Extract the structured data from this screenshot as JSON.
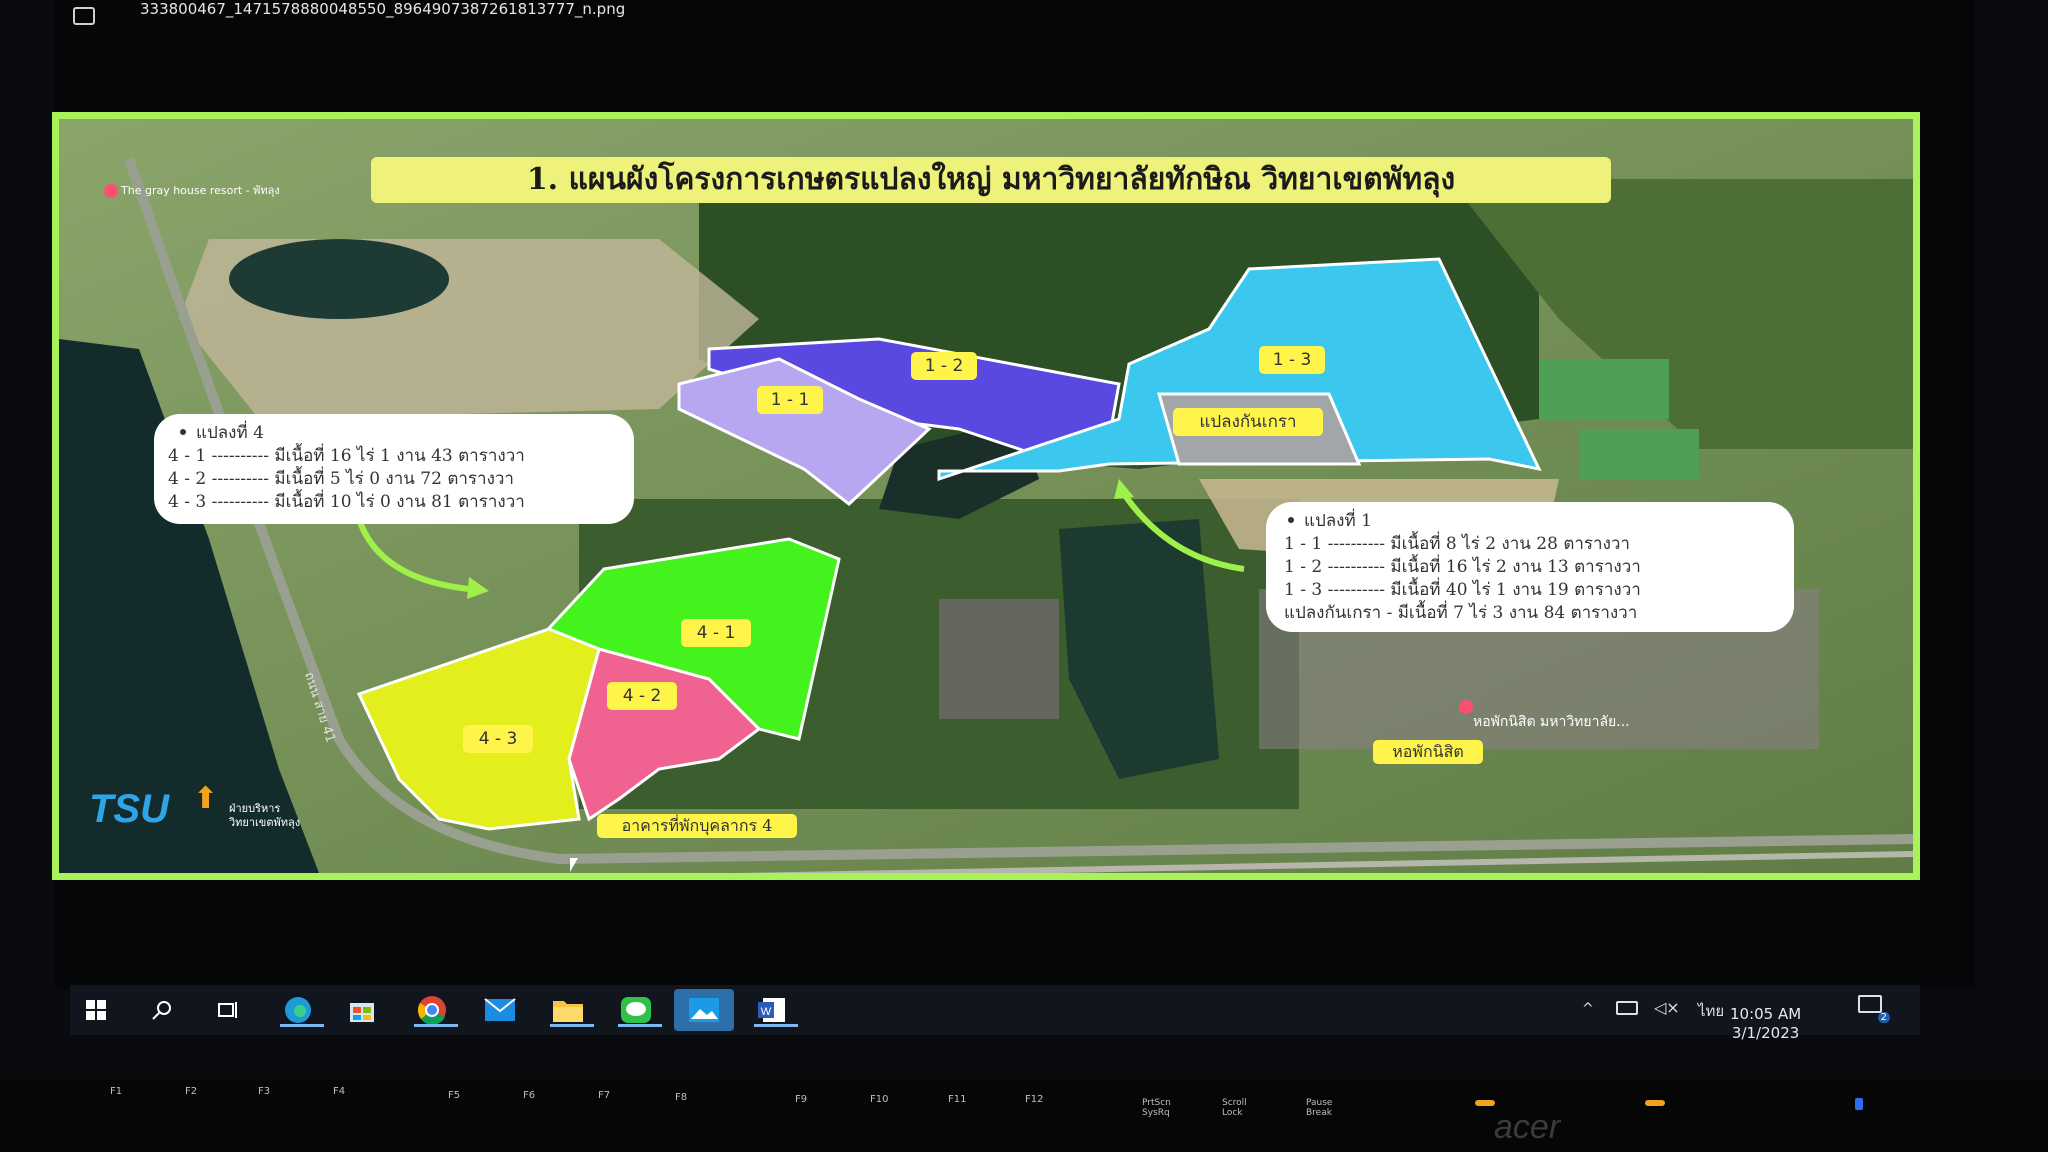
{
  "window": {
    "filename": "333800467_1471578880048550_8964907387261813777_n.png"
  },
  "slide": {
    "title": "1. แผนผังโครงการเกษตรแปลงใหญ่ มหาวิทยาลัยทักษิณ วิทยาเขตพัทลุง",
    "map_pin_label": "The gray house resort - พัทลุง",
    "road_label": "ถนน สาย 41",
    "plot_labels": [
      "1 - 1",
      "1 - 2",
      "1 - 3",
      "แปลงกันเกรา",
      "4 - 1",
      "4 - 2",
      "4 - 3"
    ],
    "place_labels": {
      "staff_building": "อาคารที่พักบุคลากร 4",
      "dormitory": "หอพักนิสิต",
      "dorm_pin": "หอพักนิสิต มหาวิทยาลัย..."
    },
    "callout_plot4": {
      "heading": "แปลงที่ 4",
      "rows": [
        "4 - 1 ----------   มีเนื้อที่  16 ไร่ 1 งาน 43  ตารางวา",
        "4 - 2 ----------   มีเนื้อที่  5  ไร่ 0 งาน 72 ตารางวา",
        "4 - 3 ----------   มีเนื้อที่  10 ไร่ 0 งาน 81 ตารางวา"
      ]
    },
    "callout_plot1": {
      "heading": "แปลงที่ 1",
      "rows": [
        "1 - 1 ----------   มีเนื้อที่  8    ไร่ 2 งาน 28 ตารางวา",
        "1 - 2 ----------   มีเนื้อที่  16  ไร่ 2 งาน 13 ตารางวา",
        "1 - 3 ----------   มีเนื้อที่  40  ไร่ 1  งาน 19 ตารางวา",
        "แปลงกันเกรา - มีเนื้อที่  7    ไร่ 3  งาน 84 ตารางวา"
      ]
    },
    "logo": {
      "text": "TSU",
      "subtitle_line1": "ฝ่ายบริหาร",
      "subtitle_line2": "วิทยาเขตพัทลุง"
    }
  },
  "taskbar": {
    "icons": [
      "windows-start-icon",
      "search-icon",
      "task-view-icon",
      "edge-icon",
      "store-icon",
      "chrome-icon",
      "mail-icon",
      "file-explorer-icon",
      "line-icon",
      "photos-icon",
      "word-icon"
    ],
    "language": "ไทย",
    "time": "10:05 AM",
    "date": "3/1/2023",
    "notification_count": "2"
  },
  "keyboard": {
    "brand": "acer",
    "keys": [
      "F1",
      "F2",
      "F3",
      "F4",
      "F5",
      "F6",
      "F7",
      "F8",
      "F9",
      "F10",
      "F11",
      "F12",
      "PrtScn SysRq",
      "Scroll Lock",
      "Pause Break"
    ]
  },
  "colors": {
    "slide_border": "#a9f25a",
    "plot_1_1": "#b7a6f0",
    "plot_1_2": "#5a49e0",
    "plot_1_3": "#3bc7ee",
    "buffer": "#a3a6a8",
    "plot_4_1": "#44f21d",
    "plot_4_2": "#f0628f",
    "plot_4_3": "#e3ef1c",
    "label_bg": "#fff44a"
  }
}
